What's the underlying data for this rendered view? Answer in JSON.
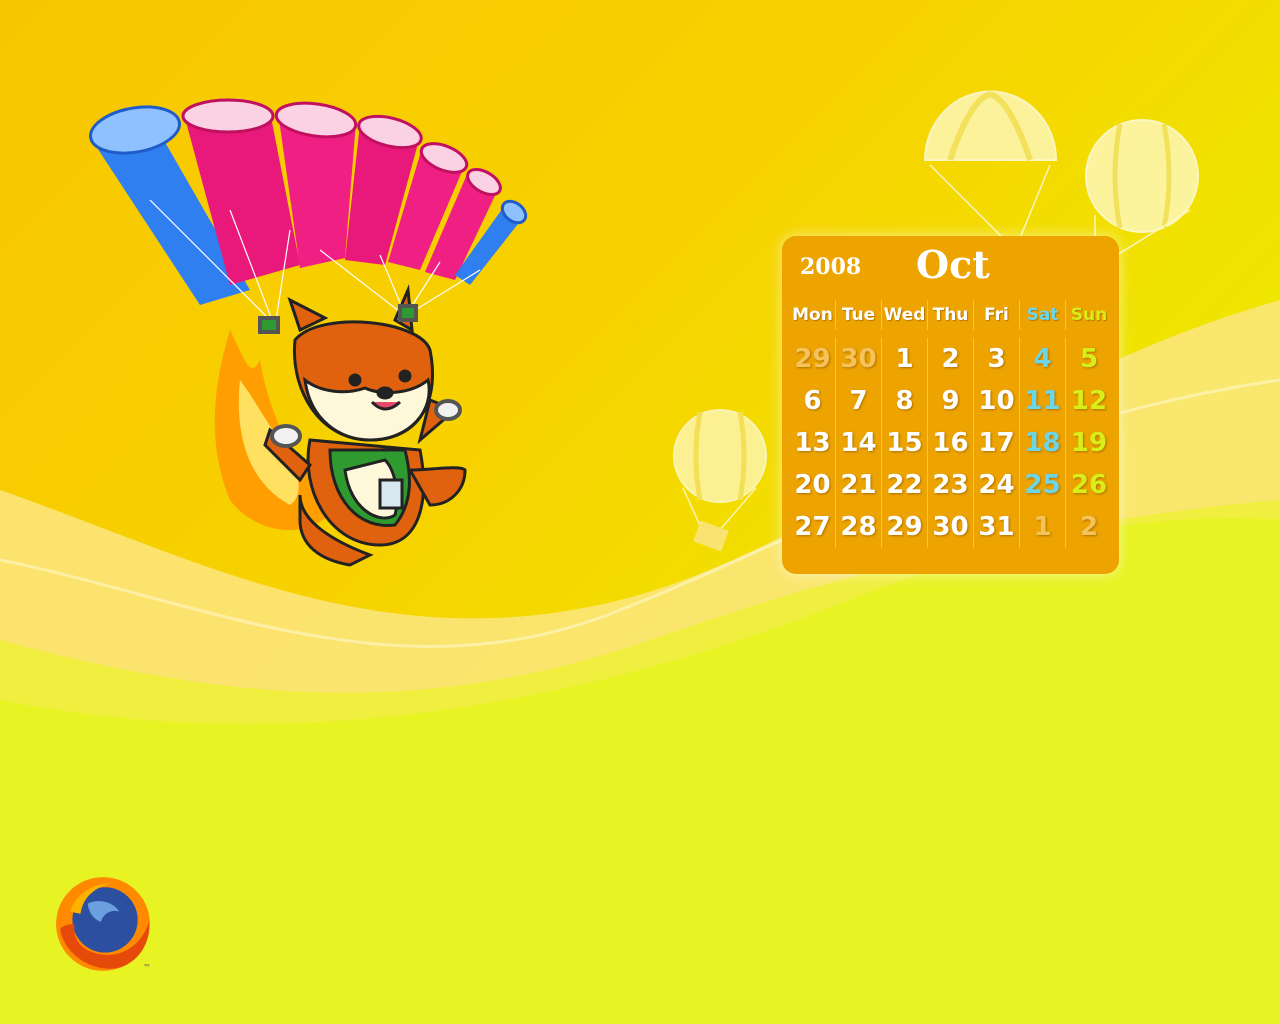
{
  "calendar": {
    "year": "2008",
    "month": "Oct",
    "weekdays": [
      {
        "label": "Mon",
        "kind": "weekday"
      },
      {
        "label": "Tue",
        "kind": "weekday"
      },
      {
        "label": "Wed",
        "kind": "weekday"
      },
      {
        "label": "Thu",
        "kind": "weekday"
      },
      {
        "label": "Fri",
        "kind": "weekday"
      },
      {
        "label": "Sat",
        "kind": "sat"
      },
      {
        "label": "Sun",
        "kind": "sun"
      }
    ],
    "weeks": [
      [
        {
          "d": "29",
          "other": true
        },
        {
          "d": "30",
          "other": true
        },
        {
          "d": "1"
        },
        {
          "d": "2"
        },
        {
          "d": "3"
        },
        {
          "d": "4"
        },
        {
          "d": "5"
        }
      ],
      [
        {
          "d": "6"
        },
        {
          "d": "7"
        },
        {
          "d": "8"
        },
        {
          "d": "9"
        },
        {
          "d": "10"
        },
        {
          "d": "11"
        },
        {
          "d": "12"
        }
      ],
      [
        {
          "d": "13"
        },
        {
          "d": "14"
        },
        {
          "d": "15"
        },
        {
          "d": "16"
        },
        {
          "d": "17"
        },
        {
          "d": "18"
        },
        {
          "d": "19"
        }
      ],
      [
        {
          "d": "20"
        },
        {
          "d": "21"
        },
        {
          "d": "22"
        },
        {
          "d": "23"
        },
        {
          "d": "24"
        },
        {
          "d": "25"
        },
        {
          "d": "26"
        }
      ],
      [
        {
          "d": "27"
        },
        {
          "d": "28"
        },
        {
          "d": "29"
        },
        {
          "d": "30"
        },
        {
          "d": "31"
        },
        {
          "d": "1",
          "other": true
        },
        {
          "d": "2",
          "other": true
        }
      ]
    ]
  },
  "logo": {
    "trademark": "™",
    "icon": "firefox-logo-icon"
  },
  "colors": {
    "panel": "#eda400",
    "saturday": "#6dd6e6",
    "sunday": "#d8ee18",
    "other_month": "#f6c35a",
    "parachute_pink": "#e8197a",
    "parachute_blue": "#2f7ff0",
    "fox_orange": "#e0620f"
  }
}
